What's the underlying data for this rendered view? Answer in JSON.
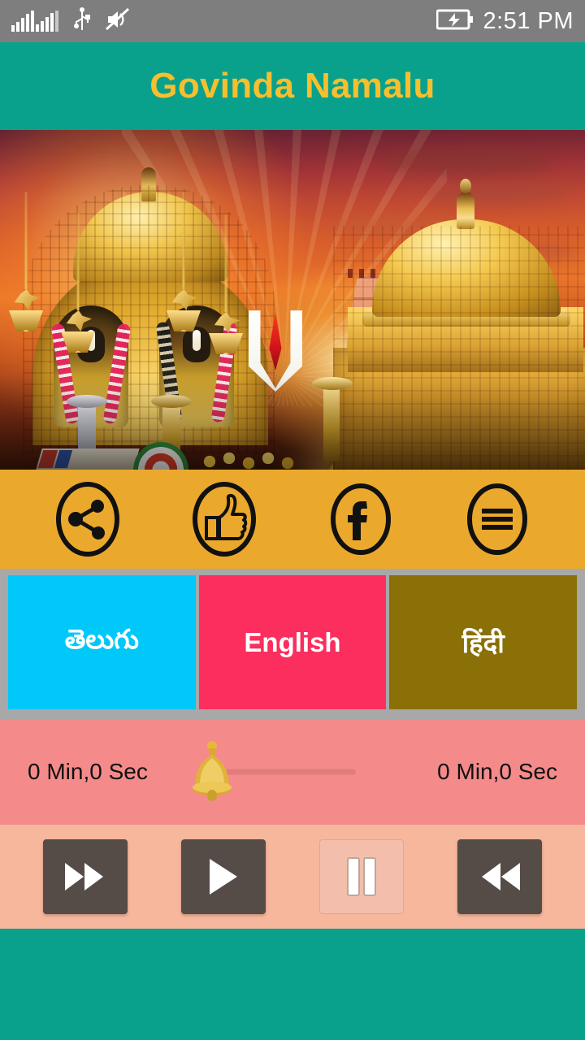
{
  "status_bar": {
    "time": "2:51 PM",
    "icons": [
      "signal-bars-icon",
      "usb-icon",
      "volume-muted-icon",
      "battery-charging-icon"
    ],
    "background_color": "#7e7e7e"
  },
  "header": {
    "title": "Govinda Namalu",
    "title_color": "#f7bf2e",
    "background_color": "#0aa18c"
  },
  "hero": {
    "alt": "Tirumala Venkateswara temple deities with golden gopuram at sunset",
    "namam_symbol": "tirumala-namam"
  },
  "social_bar": {
    "background_color": "#eaa92c",
    "buttons": [
      {
        "name": "share-button",
        "icon": "share-icon"
      },
      {
        "name": "like-button",
        "icon": "thumbs-up-icon"
      },
      {
        "name": "facebook-button",
        "icon": "facebook-icon"
      },
      {
        "name": "menu-button",
        "icon": "hamburger-menu-icon"
      }
    ]
  },
  "languages": {
    "background_color": "#a8a8a8",
    "buttons": [
      {
        "label": "తెలుగు",
        "color": "#00c8f8"
      },
      {
        "label": "English",
        "color": "#fb2e5e"
      },
      {
        "label": "हिंदी",
        "color": "#8a7006"
      }
    ]
  },
  "player": {
    "seek": {
      "background_color": "#f58a8a",
      "current_time": "0 Min,0 Sec",
      "total_time": "0 Min,0 Sec",
      "progress_percent": 0,
      "thumb_icon": "bell-icon"
    },
    "controls": {
      "background_color": "#f6b79d",
      "buttons": [
        {
          "name": "fast-forward-button",
          "icon": "fast-forward-icon",
          "enabled": true
        },
        {
          "name": "play-button",
          "icon": "play-icon",
          "enabled": true
        },
        {
          "name": "pause-button",
          "icon": "pause-icon",
          "enabled": false
        },
        {
          "name": "rewind-button",
          "icon": "rewind-icon",
          "enabled": true
        }
      ]
    }
  },
  "footer": {
    "background_color": "#0aa18c"
  }
}
